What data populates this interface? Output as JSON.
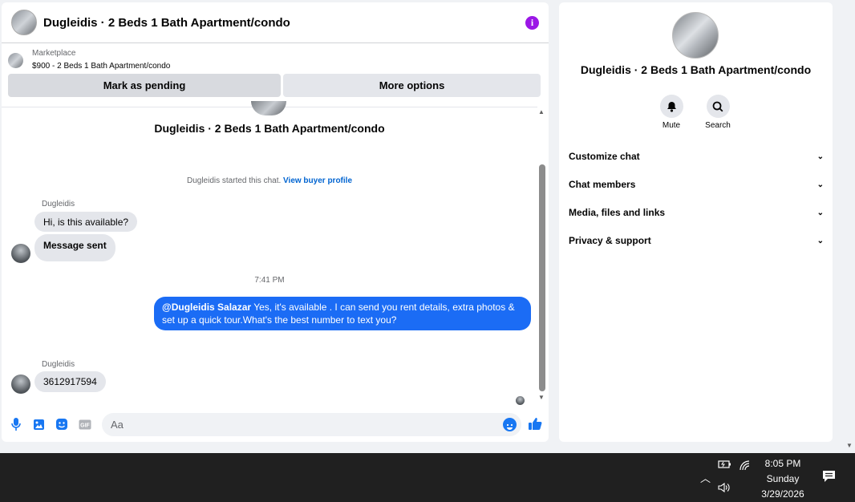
{
  "chat": {
    "title": "Dugleidis · 2 Beds 1 Bath Apartment/condo",
    "marketplace_label": "Marketplace",
    "listing": "$900 - 2 Beds 1 Bath Apartment/condo",
    "mark_pending": "Mark as pending",
    "more_options": "More options",
    "conversation_title": "Dugleidis · 2 Beds 1 Bath Apartment/condo",
    "started_text": "Dugleidis started this chat.",
    "buyer_profile_link": "View buyer profile",
    "messages": [
      {
        "sender": "Dugleidis",
        "text": "Hi, is this available?"
      },
      {
        "text": "Message sent"
      },
      {
        "time": "7:41 PM"
      },
      {
        "mention": "@Dugleidis Salazar",
        "text": " Yes, it's available .  I can send you rent details, extra photos & set up a quick tour.What's the best number to text you?"
      },
      {
        "sender": "Dugleidis",
        "text": "3612917594"
      }
    ],
    "input_placeholder": "Aa"
  },
  "side": {
    "title": "Dugleidis · 2 Beds 1 Bath Apartment/condo",
    "mute_label": "Mute",
    "search_label": "Search",
    "menu": [
      "Customize chat",
      "Chat members",
      "Media, files and links",
      "Privacy & support"
    ]
  },
  "taskbar": {
    "time": "8:05 PM",
    "day": "Sunday",
    "date": "3/29/2026"
  },
  "colors": {
    "accent": "#1b6cf5",
    "info": "#9b17e6",
    "link": "#0064d1"
  }
}
